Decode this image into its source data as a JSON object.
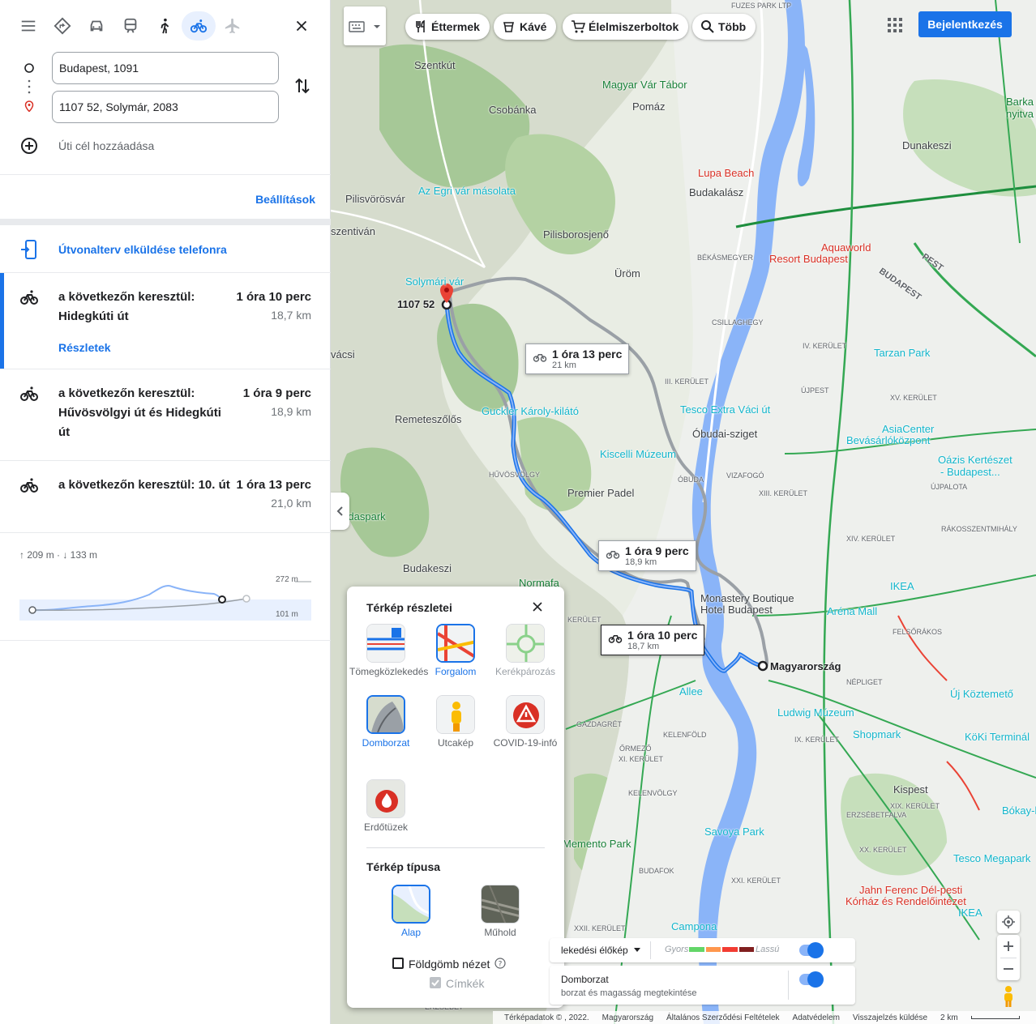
{
  "directions": {
    "origin": "Budapest, 1091",
    "destination": "1107 52, Solymár, 2083",
    "add_destination": "Úti cél hozzáadása",
    "settings": "Beállítások",
    "send_to_phone": "Útvonalterv elküldése telefonra",
    "routes": [
      {
        "via": "a következőn keresztül: Hidegkúti út",
        "time": "1 óra 10 perc",
        "distance": "18,7 km",
        "details": "Részletek"
      },
      {
        "via": "a következőn keresztül: Hűvösvölgyi út és Hidegkúti út",
        "time": "1 óra 9 perc",
        "distance": "18,9 km"
      },
      {
        "via": "a következőn keresztül: 10. út",
        "time": "1 óra 13 perc",
        "distance": "21,0 km"
      }
    ],
    "elevation": {
      "summary": "↑ 209 m · ↓ 133 m",
      "max": "272 m",
      "min": "101 m"
    }
  },
  "map": {
    "chips": [
      "Éttermek",
      "Kávé",
      "Élelmiszerboltok",
      "Több"
    ],
    "sign_in": "Bejelentkezés",
    "route_tips": [
      {
        "time": "1 óra 13 perc",
        "dist": "21 km"
      },
      {
        "time": "1 óra 9 perc",
        "dist": "18,9 km"
      },
      {
        "time": "1 óra 10 perc",
        "dist": "18,7 km"
      }
    ],
    "places": {
      "szentkut": "Szentkút",
      "magyar_var": "Magyar Vár Tábor",
      "csobanka": "Csobánka",
      "pomaz": "Pomáz",
      "dunakeszi": "Dunakeszi",
      "barka": "Barka nyitva",
      "lupa": "Lupa Beach",
      "pilisvorosvar": "Pilisvörösvár",
      "egri": "Az Egri vár másolata",
      "budakalasz": "Budakalász",
      "pilisszentivan": "szentiván",
      "pilisborosjeno": "Pilisborosjenő",
      "aquaworld": "Aquaworld",
      "aquaworld2": "Resort Budapest",
      "bekasmegyer": "BÉKÁSMEGYER",
      "solymari": "Solymári vár",
      "dest_code": "1107 52",
      "urom": "Üröm",
      "csillaghegy": "CSILLAGHEGY",
      "pest": "PEST",
      "budapest": "BUDAPEST",
      "vacsi": "vácsi",
      "iv_ker": "IV. KERÜLET",
      "tarzan": "Tarzan Park",
      "iii_ker": "III. KERÜLET",
      "ujpest": "ÚJPEST",
      "xv_ker": "XV. KERÜLET",
      "remeteszolos": "Remeteszőlős",
      "guckler": "Guckler Károly-kilátó",
      "tesco_vaci": "Tesco Extra Váci út",
      "asia": "AsiaCenter",
      "asia2": "Bevásárlóközpont",
      "oazis": "Oázis Kertészet",
      "oazis2": "- Budapest...",
      "obudai": "Óbudai-sziget",
      "kiscelli": "Kiscelli Múzeum",
      "huvosvolgy": "HŰVÖSVÖLGY",
      "obuda": "ÓBUDA",
      "vizafogo": "VIZAFOGÓ",
      "ujpalota": "ÚJPALOTA",
      "premier": "Premier Padel",
      "vadaspark": "i Vadaspark",
      "xiii_ker": "XIII. KERÜLET",
      "rakosszent": "RÁKOSSZENTMIHÁLY",
      "xiv_ker": "XIV. KERÜLET",
      "budakeszi": "Budakeszi",
      "normafa": "Normafa",
      "monastery": "Monastery Boutique",
      "monastery2": "Hotel Budapest",
      "ikea1": "IKEA",
      "arena": "Aréna Mall",
      "kerulet": "KERÜLET",
      "magyarorszag": "Magyarország",
      "felsorakos": "FELSŐRÁKOS",
      "nepliget": "NÉPLIGET",
      "allee": "Allee",
      "ludwig": "Ludwig Múzeum",
      "uj_koztemeto": "Új Köztemető",
      "gazdagret": "GAZDAGRÉT",
      "kelenfold": "KELENFÖLD",
      "ix_ker": "IX. KERÜLET",
      "shopmark": "Shopmark",
      "koki": "KöKi Terminál",
      "ormezo": "ŐRMEZŐ",
      "xi_ker": "XI. KERÜLET",
      "kispest": "Kispest",
      "xix_ker": "XIX. KERÜLET",
      "erzsebet": "ERZSÉBETFALVA",
      "bokay": "Bókay-ke",
      "kelenvolgy": "KELENVÖLGY",
      "savoya": "Savoya Park",
      "memento": "Memento Park",
      "xx_ker": "XX. KERÜLET",
      "budafok": "BUDAFOK",
      "tesco_mega": "Tesco Megapark",
      "xxi_ker": "XXI. KERÜLET",
      "jahn": "Jahn Ferenc Dél-pesti",
      "jahn2": "Kórház és Rendelőintézet",
      "ikea2": "IKEA",
      "xxii_ker": "XXII. KERÜLET",
      "campona": "Campona",
      "erzsebetv": "ERZSÉBET",
      "fuzes": "FUZES PARK LTP",
      "ervsebetv2": "ERZSÉBETV"
    },
    "layers": {
      "title": "Térkép részletei",
      "items": [
        "Tömegközlekedés",
        "Forgalom",
        "Kerékpározás",
        "Domborzat",
        "Utcakép",
        "COVID-19-infó",
        "Erdőtüzek"
      ],
      "type_title": "Térkép típusa",
      "types": [
        "Alap",
        "Műhold"
      ],
      "globe": "Földgömb nézet",
      "labels": "Címkék"
    },
    "traffic": {
      "label": "lekedési élőkép",
      "fast": "Gyors",
      "slow": "Lassú",
      "colors": [
        "#63d668",
        "#ff974d",
        "#f23c32",
        "#811f1f"
      ]
    },
    "terrain": {
      "title": "Domborzat",
      "desc": "borzat és magasság megtekintése"
    },
    "footer": [
      "Térképadatok © , 2022.",
      "Magyarország",
      "Általános Szerződési Feltételek",
      "Adatvédelem",
      "Visszajelzés küldése",
      "2 km"
    ]
  }
}
